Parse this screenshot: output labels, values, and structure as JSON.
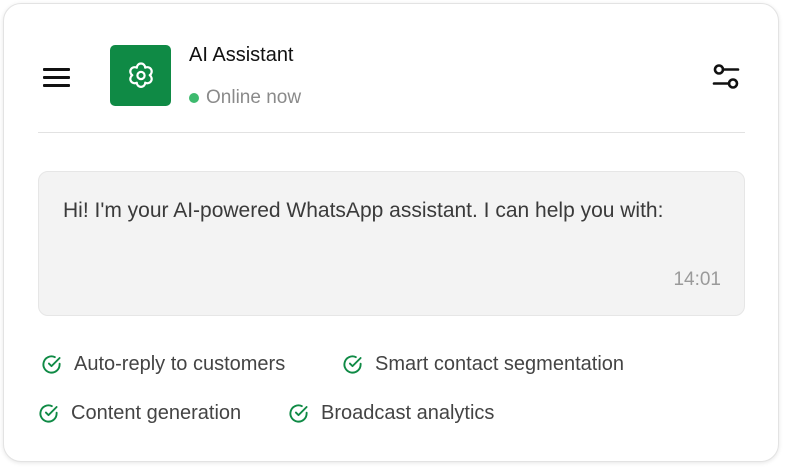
{
  "header": {
    "title": "AI Assistant",
    "status": "Online now",
    "status_color": "#3dba6e",
    "avatar_icon": "flower-gear-icon",
    "avatar_color": "#0f8a45",
    "menu_icon": "hamburger-menu-icon",
    "settings_icon": "sliders-icon"
  },
  "message": {
    "text": "Hi! I'm your AI-powered WhatsApp assistant. I can help you with:",
    "time": "14:01"
  },
  "features": [
    {
      "label": "Auto-reply to customers",
      "icon": "check-circle-icon"
    },
    {
      "label": "Smart contact segmentation",
      "icon": "check-circle-icon"
    },
    {
      "label": "Content generation",
      "icon": "check-circle-icon"
    },
    {
      "label": "Broadcast analytics",
      "icon": "check-circle-icon"
    }
  ],
  "accent_color": "#0f8a45"
}
